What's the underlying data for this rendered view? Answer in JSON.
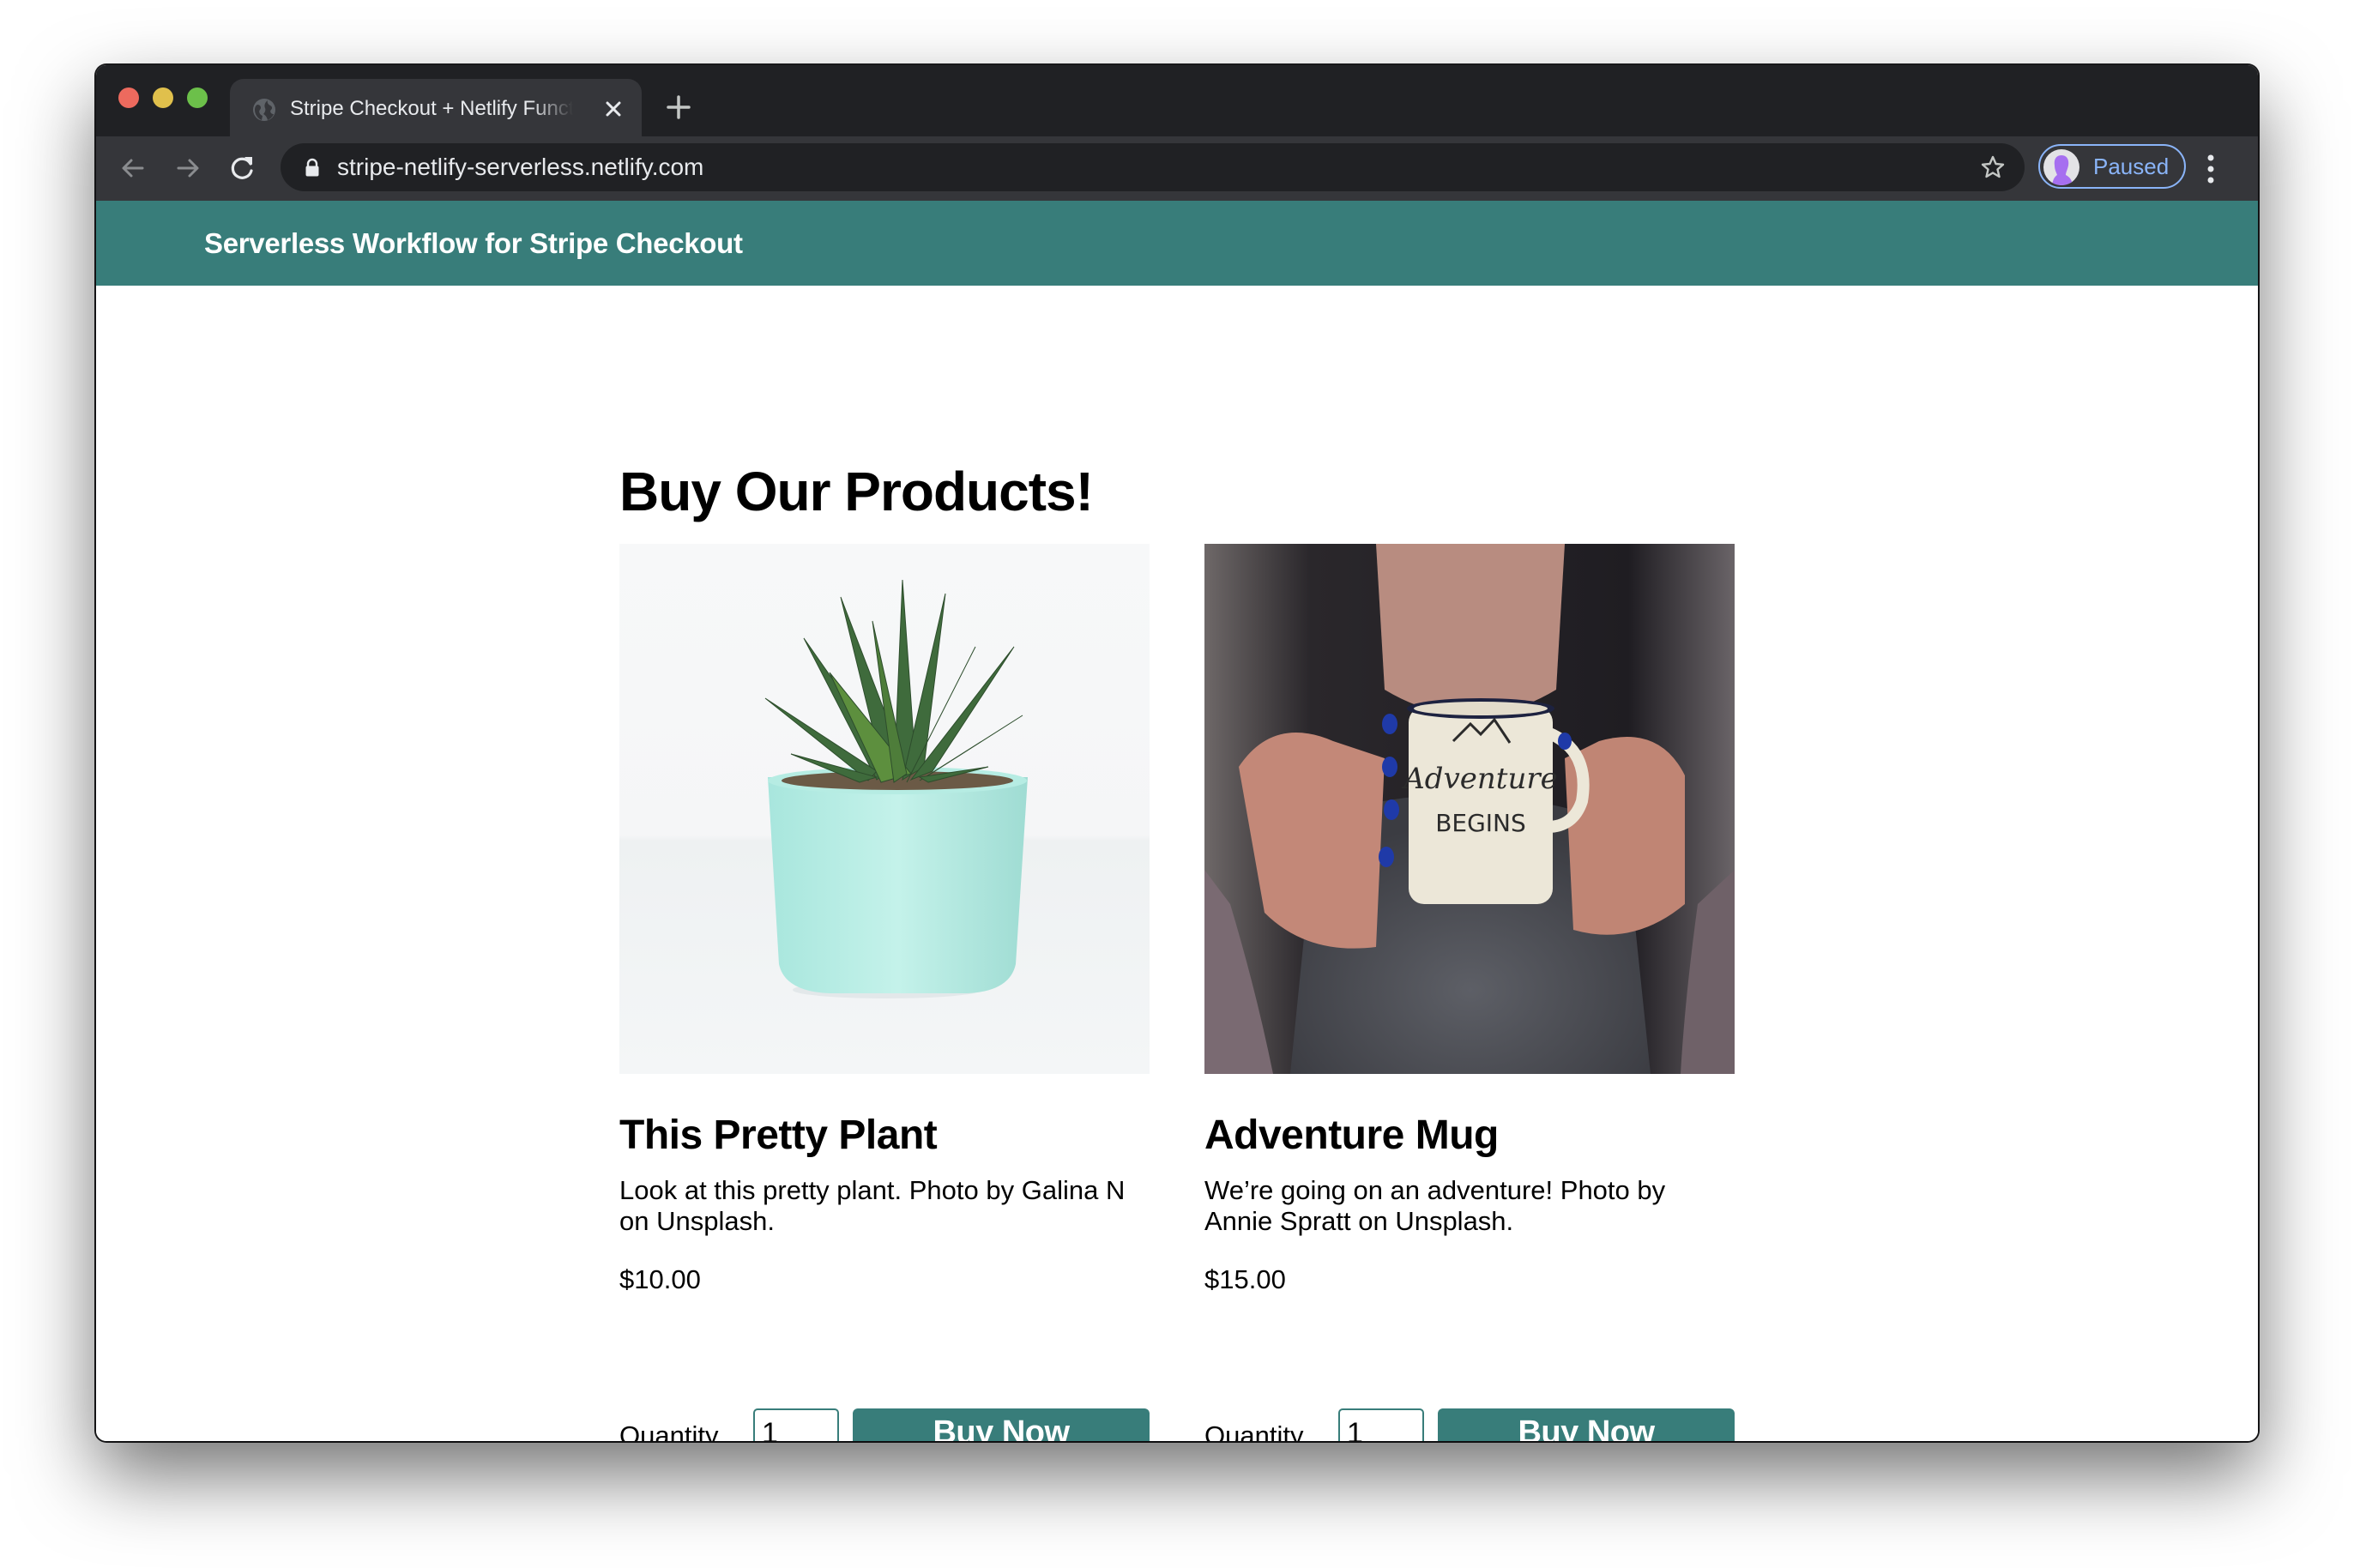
{
  "browser": {
    "tab": {
      "title": "Stripe Checkout + Netlify Functions",
      "favicon": "globe-icon",
      "close_icon": "close-icon"
    },
    "new_tab_icon": "plus-icon",
    "toolbar": {
      "back_icon": "arrow-left-icon",
      "forward_icon": "arrow-right-icon",
      "reload_icon": "reload-icon",
      "lock_icon": "lock-icon",
      "url": "stripe-netlify-serverless.netlify.com",
      "bookmark_icon": "star-icon",
      "profile_status": "Paused",
      "menu_icon": "more-vert-icon"
    }
  },
  "site": {
    "header_title": "Serverless Workflow for Stripe Checkout",
    "brand_color": "#387d7a"
  },
  "main": {
    "heading": "Buy Our Products!",
    "products": [
      {
        "image": "potted-succulent-photo",
        "name": "This Pretty Plant",
        "description": "Look at this pretty plant. Photo by Galina N on Unsplash.",
        "price": "$10.00",
        "quantity_label": "Quantity",
        "quantity_value": "1",
        "button_label": "Buy Now"
      },
      {
        "image": "adventure-mug-photo",
        "name": "Adventure Mug",
        "description": "We’re going on an adventure! Photo by Annie Spratt on Unsplash.",
        "price": "$15.00",
        "quantity_label": "Quantity",
        "quantity_value": "1",
        "button_label": "Buy Now"
      }
    ]
  }
}
